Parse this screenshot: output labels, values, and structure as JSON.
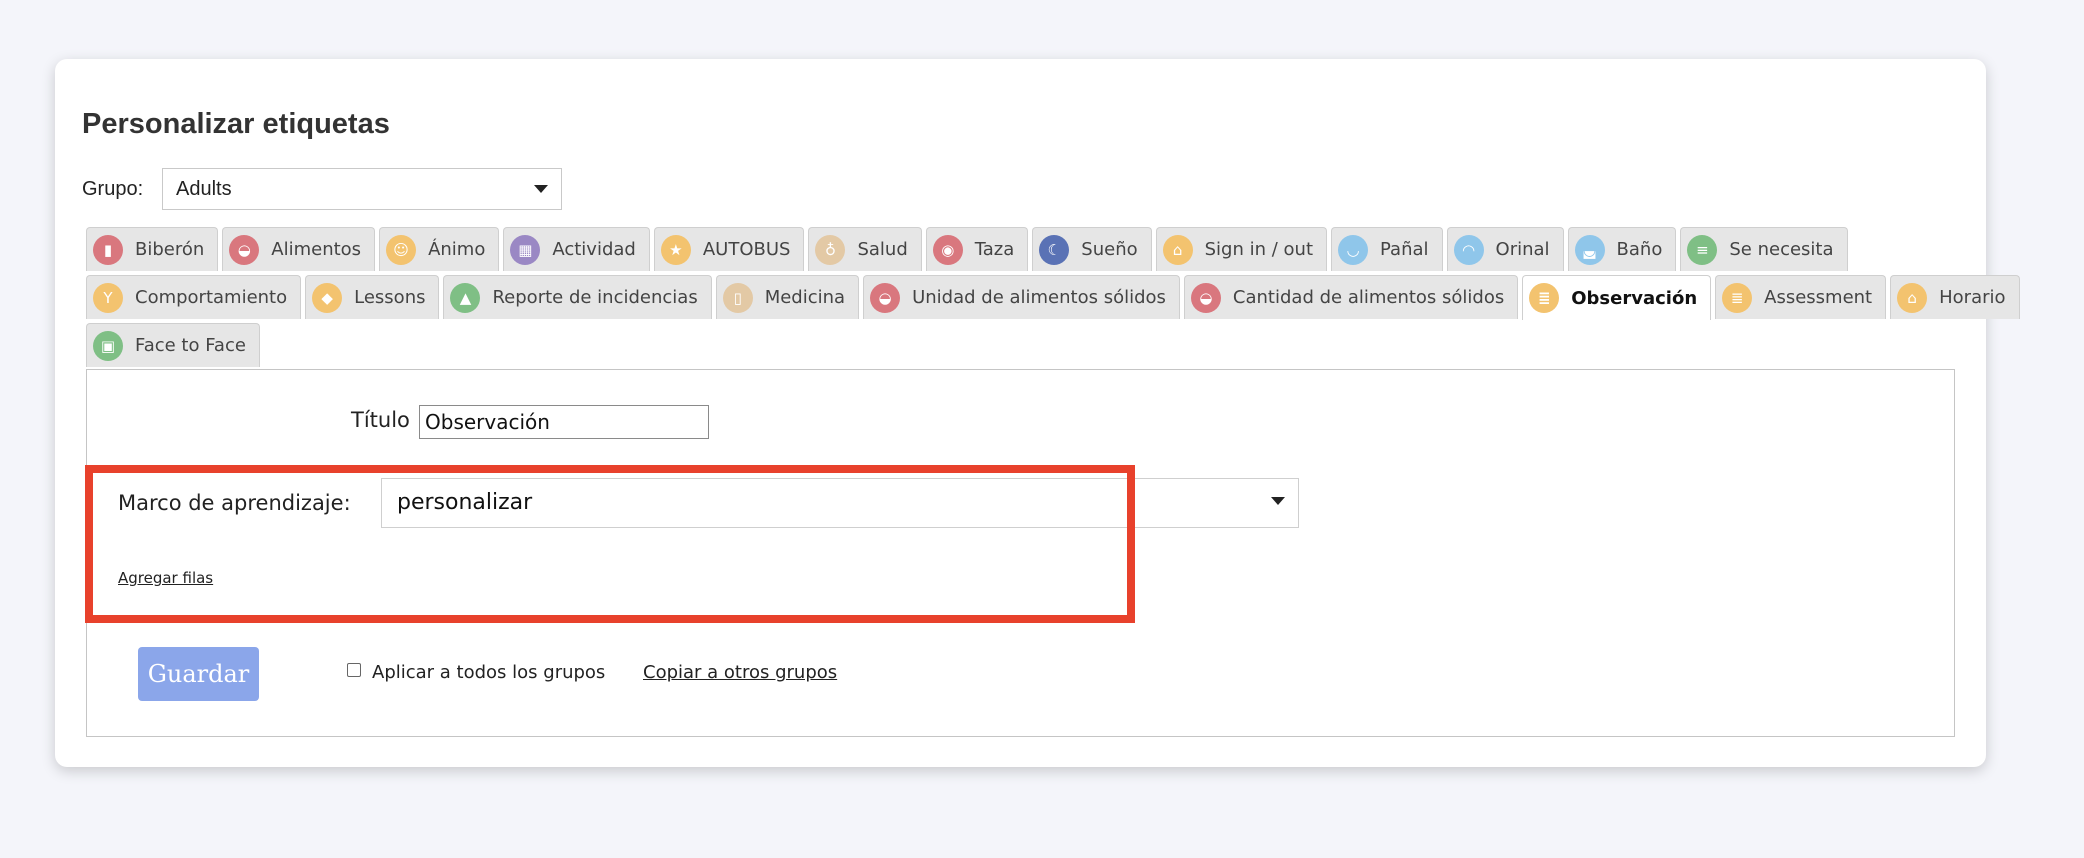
{
  "page": {
    "title": "Personalizar etiquetas"
  },
  "group": {
    "label": "Grupo:",
    "selected": "Adults"
  },
  "tabs_row1": [
    {
      "label": "Biberón",
      "icon": "baby-bottle-icon",
      "color": "#d9777e",
      "glyph": "▮"
    },
    {
      "label": "Alimentos",
      "icon": "food-bowl-icon",
      "color": "#d9777e",
      "glyph": "◒"
    },
    {
      "label": "Ánimo",
      "icon": "mood-face-icon",
      "color": "#f3c36f",
      "glyph": "☺"
    },
    {
      "label": "Actividad",
      "icon": "blocks-icon",
      "color": "#9a88c4",
      "glyph": "▦"
    },
    {
      "label": "AUTOBUS",
      "icon": "star-icon",
      "color": "#f3c36f",
      "glyph": "★"
    },
    {
      "label": "Salud",
      "icon": "stethoscope-icon",
      "color": "#e3c9a5",
      "glyph": "♁"
    },
    {
      "label": "Taza",
      "icon": "sippy-cup-icon",
      "color": "#d9777e",
      "glyph": "◉"
    },
    {
      "label": "Sueño",
      "icon": "moon-icon",
      "color": "#5a72b5",
      "glyph": "☾"
    },
    {
      "label": "Sign in / out",
      "icon": "house-icon",
      "color": "#f3c36f",
      "glyph": "⌂"
    },
    {
      "label": "Pañal",
      "icon": "diaper-icon",
      "color": "#8fc6ea",
      "glyph": "◡"
    },
    {
      "label": "Orinal",
      "icon": "potty-icon",
      "color": "#8fc6ea",
      "glyph": "◠"
    },
    {
      "label": "Baño",
      "icon": "bathtub-icon",
      "color": "#8fc6ea",
      "glyph": "◛"
    },
    {
      "label": "Se necesita",
      "icon": "checklist-icon",
      "color": "#7fbf85",
      "glyph": "≡"
    }
  ],
  "tabs_row2": [
    {
      "label": "Comportamiento",
      "icon": "behavior-icon",
      "color": "#f3c36f",
      "glyph": "Y"
    },
    {
      "label": "Lessons",
      "icon": "graduation-cap-icon",
      "color": "#f3c36f",
      "glyph": "◆"
    },
    {
      "label": "Reporte de incidencias",
      "icon": "warning-icon",
      "color": "#7fbf85",
      "glyph": "▲"
    },
    {
      "label": "Medicina",
      "icon": "medicine-bottle-icon",
      "color": "#e3c9a5",
      "glyph": "▯"
    },
    {
      "label": "Unidad de alimentos sólidos",
      "icon": "solid-food-unit-icon",
      "color": "#d9777e",
      "glyph": "◒"
    },
    {
      "label": "Cantidad de alimentos sólidos",
      "icon": "solid-food-amount-icon",
      "color": "#d9777e",
      "glyph": "◒"
    },
    {
      "label": "Observación",
      "icon": "observation-notes-icon",
      "color": "#f3c36f",
      "glyph": "≣",
      "active": true
    },
    {
      "label": "Assessment",
      "icon": "assessment-notes-icon",
      "color": "#f3c36f",
      "glyph": "≣"
    },
    {
      "label": "Horario",
      "icon": "schedule-house-icon",
      "color": "#f3c36f",
      "glyph": "⌂"
    }
  ],
  "tabs_row3": [
    {
      "label": "Face to Face",
      "icon": "face-to-face-icon",
      "color": "#7fbf85",
      "glyph": "▣"
    }
  ],
  "form": {
    "titulo_label": "Título",
    "titulo_value": "Observación",
    "marco_label": "Marco de aprendizaje:",
    "marco_selected": "personalizar",
    "agregar_filas": "Agregar filas",
    "guardar": "Guardar",
    "apply_all_label": "Aplicar a todos los grupos",
    "apply_all_checked": false,
    "copiar": "Copiar a otros grupos"
  },
  "colors": {
    "highlight": "#e8412c",
    "save_button": "#8ba6ea",
    "background": "#f4f5fa"
  }
}
